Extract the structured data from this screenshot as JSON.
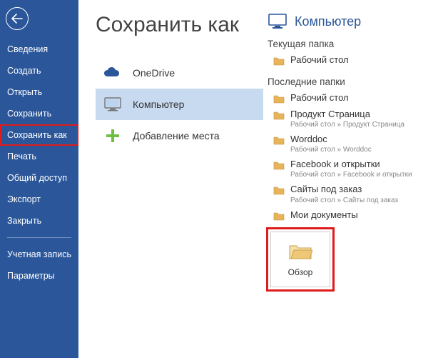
{
  "sidebar": {
    "items": [
      {
        "label": "Сведения"
      },
      {
        "label": "Создать"
      },
      {
        "label": "Открыть"
      },
      {
        "label": "Сохранить"
      },
      {
        "label": "Сохранить как"
      },
      {
        "label": "Печать"
      },
      {
        "label": "Общий доступ"
      },
      {
        "label": "Экспорт"
      },
      {
        "label": "Закрыть"
      }
    ],
    "footer": [
      {
        "label": "Учетная запись"
      },
      {
        "label": "Параметры"
      }
    ]
  },
  "page_title": "Сохранить как",
  "places": {
    "onedrive": "OneDrive",
    "computer": "Компьютер",
    "addplace": "Добавление места"
  },
  "right": {
    "computer_label": "Компьютер",
    "current_folder_label": "Текущая папка",
    "current_folder": {
      "name": "Рабочий стол"
    },
    "recent_label": "Последние папки",
    "recent": [
      {
        "name": "Рабочий стол",
        "path": ""
      },
      {
        "name": "Продукт Страница",
        "path": "Рабочий стол » Продукт Страница"
      },
      {
        "name": "Worddoc",
        "path": "Рабочий стол » Worddoc"
      },
      {
        "name": "Facebook и открытки",
        "path": "Рабочий стол » Facebook и открытки"
      },
      {
        "name": "Сайты под заказ",
        "path": "Рабочий стол » Сайты под заказ"
      },
      {
        "name": "Мои документы",
        "path": ""
      }
    ],
    "browse_label": "Обзор"
  },
  "colors": {
    "brand": "#2b579a",
    "highlight": "#e01b1b"
  }
}
